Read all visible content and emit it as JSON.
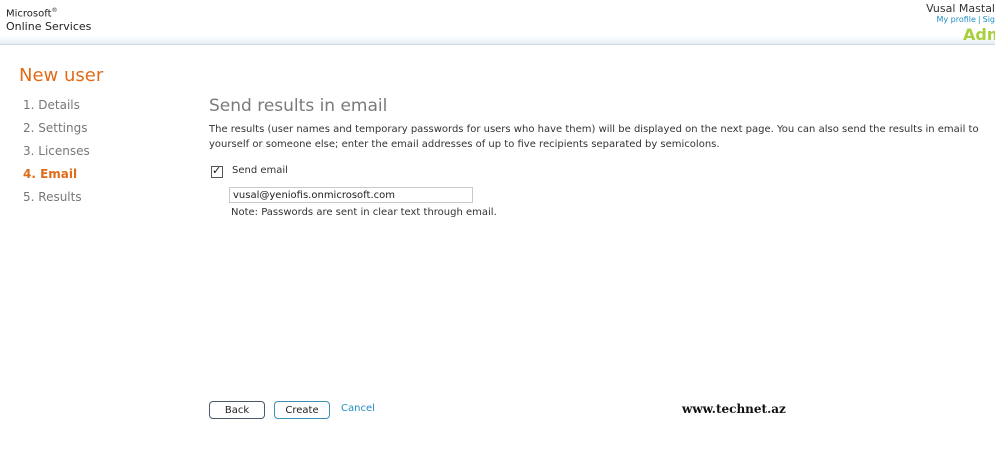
{
  "header": {
    "logo_line1": "Microsoft",
    "logo_trademark": "®",
    "logo_line2": "Online Services",
    "user_name": "Vusal Mastal",
    "links": {
      "my_profile": "My profile",
      "separator": "|",
      "sign": "Sig"
    },
    "admin_label": "Adm"
  },
  "sidebar": {
    "title": "New user",
    "steps": [
      {
        "label": "1.  Details"
      },
      {
        "label": "2.  Settings"
      },
      {
        "label": "3.  Licenses"
      },
      {
        "label": "4.  Email",
        "active": true
      },
      {
        "label": "5.  Results"
      }
    ]
  },
  "main": {
    "title": "Send results in email",
    "description": "The results (user names and temporary passwords for users who have them) will be displayed on the next page. You can also send the results in email to yourself or someone else; enter the email addresses of up to five recipients separated by semicolons.",
    "send_email": {
      "label": "Send email",
      "checked": true
    },
    "email_field": {
      "value": "vusal@yeniofis.onmicrosoft.com"
    },
    "note": "Note: Passwords are sent in clear text through email."
  },
  "footer": {
    "back_label": "Back",
    "create_label": "Create",
    "cancel_label": "Cancel"
  },
  "watermark": "www.technet.az",
  "colors": {
    "accent_orange": "#e06c1a",
    "link_blue": "#1f8fc4",
    "admin_green": "#a8d03c"
  }
}
